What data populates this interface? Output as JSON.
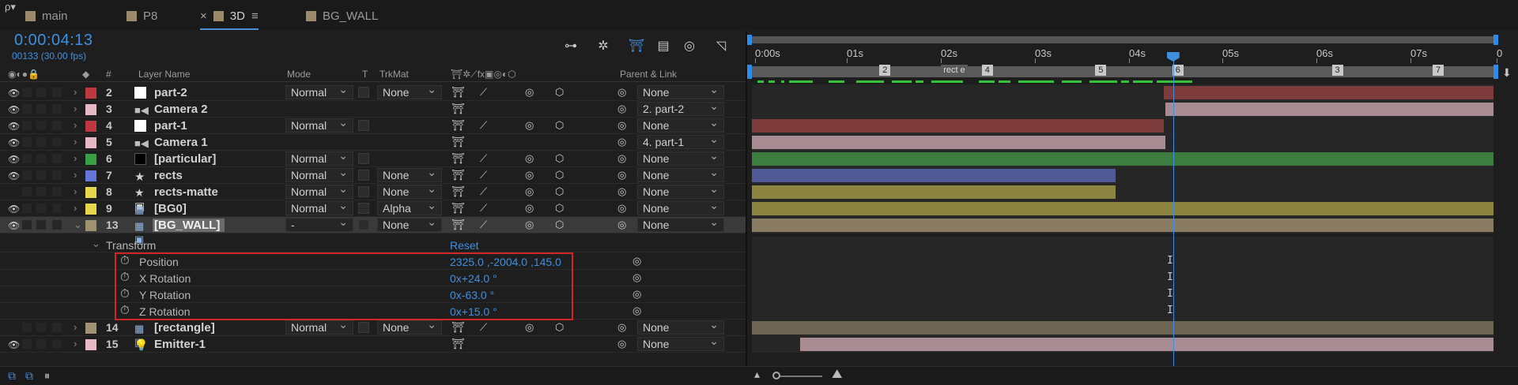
{
  "tabs": [
    {
      "label": "main",
      "close": ""
    },
    {
      "label": "P8",
      "close": ""
    },
    {
      "label": "3D",
      "close": "×",
      "menu": "≡",
      "active": true
    },
    {
      "label": "BG_WALL",
      "close": ""
    }
  ],
  "header": {
    "timecode": "0:00:04:13",
    "frames": "00133 (30.00 fps)",
    "search_icon": "ρ▾"
  },
  "columns": {
    "hash": "#",
    "layer_name": "Layer Name",
    "mode": "Mode",
    "t": "T",
    "trkmat": "TrkMat",
    "parent": "Parent & Link"
  },
  "layers": [
    {
      "num": "2",
      "name": "part-2",
      "label_color": "#c0383f",
      "icon": "solid-white",
      "mode": "Normal",
      "trkmat": "None",
      "parent": "None",
      "bar_color": "#7d3b3b",
      "bar_start": 0.555,
      "bar_end": 1.0,
      "eye": true
    },
    {
      "num": "3",
      "name": "Camera 2",
      "label_color": "#e7b9c4",
      "icon": "camera",
      "mode": "",
      "trkmat": "",
      "parent": "2. part-2",
      "bar_color": "#a98b93",
      "bar_start": 0.558,
      "bar_end": 1.0,
      "eye": true
    },
    {
      "num": "4",
      "name": "part-1",
      "label_color": "#c0383f",
      "icon": "solid-white",
      "mode": "Normal",
      "trkmat": "",
      "parent": "None",
      "bar_color": "#7d3b3b",
      "bar_start": 0.0,
      "bar_end": 0.555,
      "eye": true
    },
    {
      "num": "5",
      "name": "Camera 1",
      "label_color": "#e7b9c4",
      "icon": "camera",
      "mode": "",
      "trkmat": "",
      "parent": "4. part-1",
      "bar_color": "#a98b93",
      "bar_start": 0.0,
      "bar_end": 0.558,
      "eye": true
    },
    {
      "num": "6",
      "name": "[particular]",
      "label_color": "#3aa045",
      "icon": "solid-black",
      "mode": "Normal",
      "trkmat": "",
      "parent": "None",
      "bar_color": "#3d7d3f",
      "bar_start": 0.0,
      "bar_end": 1.0,
      "eye": true
    },
    {
      "num": "7",
      "name": "rects",
      "label_color": "#6676d8",
      "icon": "star",
      "mode": "Normal",
      "trkmat": "None",
      "parent": "None",
      "bar_color": "#4f5a96",
      "bar_start": 0.0,
      "bar_end": 0.49,
      "eye": true
    },
    {
      "num": "8",
      "name": "rects-matte",
      "label_color": "#e6d64c",
      "icon": "star-matte",
      "mode": "Normal",
      "trkmat": "None",
      "parent": "None",
      "bar_color": "#8b8541",
      "bar_start": 0.0,
      "bar_end": 0.49,
      "eye": false
    },
    {
      "num": "9",
      "name": "[BG0]",
      "label_color": "#e6d64c",
      "icon": "precomp",
      "mode": "Normal",
      "trkmat": "Alpha",
      "parent": "None",
      "bar_color": "#8b8541",
      "bar_start": 0.0,
      "bar_end": 1.0,
      "eye": true
    },
    {
      "num": "13",
      "name": "[BG_WALL]",
      "label_color": "#a0916f",
      "icon": "precomp",
      "mode": "-",
      "trkmat": "None",
      "parent": "None",
      "bar_color": "#8a7c63",
      "bar_start": 0.0,
      "bar_end": 1.0,
      "eye": true,
      "selected": true,
      "expanded": true
    }
  ],
  "transform": {
    "group_label": "Transform",
    "reset_label": "Reset",
    "props": [
      {
        "name": "Position",
        "value": "2325.0 ,-2004.0 ,145.0"
      },
      {
        "name": "X Rotation",
        "value": "0x+24.0 °"
      },
      {
        "name": "Y Rotation",
        "value": "0x-63.0 °"
      },
      {
        "name": "Z Rotation",
        "value": "0x+15.0 °"
      }
    ]
  },
  "layers_after": [
    {
      "num": "14",
      "name": "[rectangle]",
      "label_color": "#a0916f",
      "icon": "precomp",
      "mode": "Normal",
      "trkmat": "None",
      "parent": "None",
      "bar_color": "#6e6453",
      "bar_start": 0.0,
      "bar_end": 1.0,
      "eye": false
    },
    {
      "num": "15",
      "name": "Emitter-1",
      "label_color": "#e7b9c4",
      "icon": "light",
      "mode": "",
      "trkmat": "",
      "parent": "None",
      "bar_color": "#a98b93",
      "bar_start": 0.065,
      "bar_end": 1.0,
      "eye": true
    }
  ],
  "ruler": {
    "ticks": [
      "0:00s",
      "01s",
      "02s",
      "03s",
      "04s",
      "05s",
      "06s",
      "07s",
      "0"
    ]
  },
  "markers": [
    {
      "label": "2",
      "pos": 0.172
    },
    {
      "label": "rect e",
      "pos": 0.255,
      "wide": true
    },
    {
      "label": "4",
      "pos": 0.31
    },
    {
      "label": "5",
      "pos": 0.463
    },
    {
      "label": "6",
      "pos": 0.567
    },
    {
      "label": "3",
      "pos": 0.782
    },
    {
      "label": "7",
      "pos": 0.918
    }
  ],
  "playhead_pos": 0.568,
  "colors": {
    "accent": "#3f8fe0",
    "highlight_box": "#d02626"
  }
}
